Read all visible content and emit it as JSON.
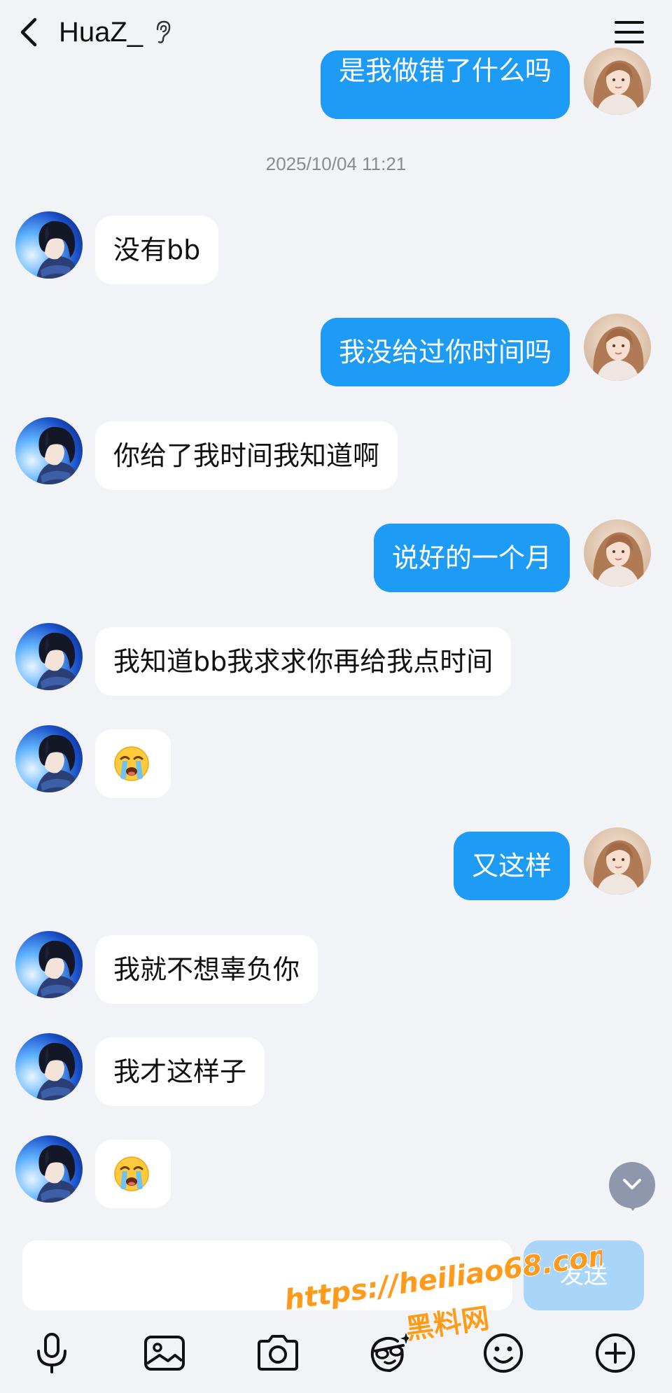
{
  "header": {
    "contact_name": "HuaZ_",
    "icons": [
      "back-arrow-icon",
      "ear-icon",
      "menu-icon"
    ]
  },
  "chat": {
    "timestamp": "2025/10/04 11:21",
    "messages": [
      {
        "from": "me",
        "text": "是我做错了什么吗"
      },
      {
        "from": "them",
        "text": "没有bb"
      },
      {
        "from": "me",
        "text": "我没给过你时间吗"
      },
      {
        "from": "them",
        "text": "你给了我时间我知道啊"
      },
      {
        "from": "me",
        "text": "说好的一个月"
      },
      {
        "from": "them",
        "text": "我知道bb我求求你再给我点时间"
      },
      {
        "from": "them",
        "emoji": "loudly-crying-face"
      },
      {
        "from": "me",
        "text": "又这样"
      },
      {
        "from": "them",
        "text": "我就不想辜负你"
      },
      {
        "from": "them",
        "text": "我才这样子"
      },
      {
        "from": "them",
        "emoji": "loudly-crying-face"
      }
    ]
  },
  "composer": {
    "input_value": "",
    "send_label": "发送"
  },
  "toolbar": {
    "items": [
      "microphone-icon",
      "image-icon",
      "camera-icon",
      "sticker-icon",
      "emoji-icon",
      "plus-icon"
    ]
  },
  "watermark": {
    "line1": "https://heiliao68.com",
    "line2": "黑料网"
  },
  "colors": {
    "background": "#f2f3f7",
    "outgoing_bubble": "#1e9cf5",
    "incoming_bubble": "#ffffff",
    "send_button": "#a9d6f8",
    "watermark": "#ff9a1a"
  }
}
